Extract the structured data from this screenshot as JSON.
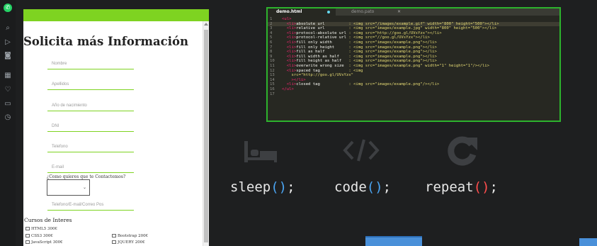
{
  "sidebar": {
    "icons": [
      "whatsapp-icon",
      "search-icon",
      "play-icon",
      "camera-icon",
      "grid-icon",
      "heart-icon",
      "wallet-icon",
      "history-icon"
    ]
  },
  "form": {
    "title": "Solicita más Información",
    "fields": [
      {
        "placeholder": "Nombre"
      },
      {
        "placeholder": "Apellidos"
      },
      {
        "placeholder": "Año de nacimiento"
      },
      {
        "placeholder": "DNI"
      },
      {
        "placeholder": "Telefono"
      },
      {
        "placeholder": "E-mail"
      }
    ],
    "question": "¿Como quieres que te Contactemos?",
    "contact_placeholder": "Telefono/E-mail/Correo Pos",
    "cursos_title": "Cursos de Interes",
    "cursos": [
      {
        "label": "HTML5 300€"
      },
      {
        "label": "Bootstrap 200€"
      },
      {
        "label": "CSS3 300€"
      },
      {
        "label": "JQUERY 200€"
      },
      {
        "label": "JavaScript 300€"
      }
    ]
  },
  "editor": {
    "tab_active": "demo.html",
    "tab_inactive": "demo.pato",
    "lines": [
      {
        "n": "1",
        "tag": "<ul>",
        "label": "",
        "attr": ""
      },
      {
        "n": "2",
        "tag": "  <li>",
        "label": "absolute url",
        "attr": ": <img src=\"/images/example.gif\" width=\"800\" height=\"500\"></li>"
      },
      {
        "n": "3",
        "tag": "  <li>",
        "label": "relative url",
        "attr": ": <img src=\"images/example.jpg\" width=\"800\" height=\"500\"></li>"
      },
      {
        "n": "4",
        "tag": "  <li>",
        "label": "protocol-absolute url",
        "attr": ": <img src=\"http://goo.gl/UVsYzx\"></li>"
      },
      {
        "n": "5",
        "tag": "  <li>",
        "label": "protocol-relative url",
        "attr": ": <img src=\"//goo.gl/UVsYzx\"></li>"
      },
      {
        "n": "6",
        "tag": "  <li>",
        "label": "fill only width",
        "attr": ": <img src=\"images/example.png\"></li>"
      },
      {
        "n": "7",
        "tag": "  <li>",
        "label": "fill only height",
        "attr": ": <img src=\"images/example.png\"></li>"
      },
      {
        "n": "8",
        "tag": "  <li>",
        "label": "fill as half",
        "attr": ": <img src=\"images/example.png\"></li>"
      },
      {
        "n": "9",
        "tag": "  <li>",
        "label": "fill width as half",
        "attr": ": <img src=\"images/example.png\"></li>"
      },
      {
        "n": "10",
        "tag": "  <li>",
        "label": "fill height as half",
        "attr": ": <img src=\"images/example.png\"></li>"
      },
      {
        "n": "11",
        "tag": "  <li>",
        "label": "overwrite wrong size",
        "attr": ": <img src=\"images/example.png\" width=\"1\" height=\"1\"/></li>"
      },
      {
        "n": "12",
        "tag": "  <li>",
        "label": "spaced tag",
        "attr": ": <img"
      },
      {
        "n": "13",
        "tag": "",
        "label": "    src=\"http://goo.gl/UVsYzx\"",
        "attr": ""
      },
      {
        "n": "14",
        "tag": "    ></li>",
        "label": "",
        "attr": ""
      },
      {
        "n": "15",
        "tag": "  <li>",
        "label": "closed tag",
        "attr": ": <img src=\"images/example.png\"/></li>"
      },
      {
        "n": "16",
        "tag": "</ul>",
        "label": "",
        "attr": ""
      },
      {
        "n": "17",
        "tag": "",
        "label": "",
        "attr": ""
      }
    ]
  },
  "tagline": {
    "sleep": "sleep",
    "code": "code",
    "repeat": "repeat",
    "call": "()",
    "semi": ";"
  },
  "colors": {
    "accent_green": "#7ed321",
    "code_blue": "#4aa3f0",
    "repeat_red": "#ff4d4d"
  }
}
